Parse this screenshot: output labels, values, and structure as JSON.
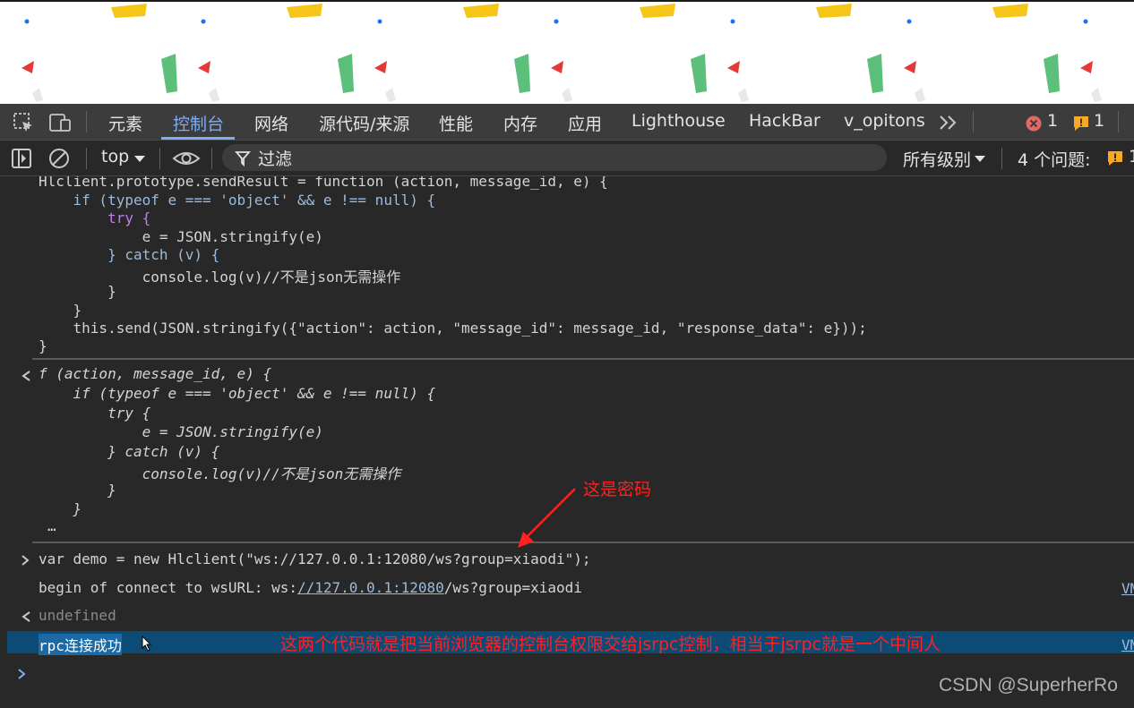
{
  "tabs": {
    "items": [
      "元素",
      "控制台",
      "网络",
      "源代码/来源",
      "性能",
      "内存",
      "应用",
      "Lighthouse",
      "HackBar",
      "v_opitons"
    ],
    "error_count": "1",
    "warning_count": "1"
  },
  "toolbar": {
    "context": "top",
    "filter_placeholder": "过滤",
    "levels": "所有级别",
    "issues": "4 个问题:",
    "issues_count": "1"
  },
  "console": {
    "src_line1": "Hlclient.prototype.sendResult = function (action, message_id, e) {",
    "src_line2": "    if (typeof e === 'object' && e !== null) {",
    "src_line3": "        try {",
    "src_line4": "            e = JSON.stringify(e)",
    "src_line5": "        } catch (v) {",
    "src_line6": "            console.log(v)//不是json无需操作",
    "src_line7": "        }",
    "src_line8": "    }",
    "src_line9": "    this.send(JSON.stringify({\"action\": action, \"message_id\": message_id, \"response_data\": e}));",
    "src_line10": "}",
    "ret_line1": "f (action, message_id, e) {",
    "ret_line2": "    if (typeof e === 'object' && e !== null) {",
    "ret_line3": "        try {",
    "ret_line4": "            e = JSON.stringify(e)",
    "ret_line5": "        } catch (v) {",
    "ret_line6": "            console.log(v)//不是json无需操作",
    "ret_line7": "        }",
    "ret_line8": "    }",
    "ret_line9": "…",
    "input_code": "var demo = new Hlclient(\"ws://127.0.0.1:12080/ws?group=xiaodi\");",
    "log_prefix": "begin of connect to wsURL: ws:",
    "log_url": "//127.0.0.1:12080",
    "log_suffix": "/ws?group=xiaodi",
    "log_source": "VM",
    "undefined_text": "undefined",
    "success_text": "rpc连接成功",
    "success_source": "VM"
  },
  "annotations": {
    "password": "这是密码",
    "explain": "这两个代码就是把当前浏览器的控制台权限交给jsrpc控制，相当于jsrpc就是一个中间人"
  },
  "watermark": "CSDN @SuperherRo",
  "colors": {
    "accent": "#7cacf8",
    "annotation_red": "#ff2020",
    "selection": "#0d4b77"
  }
}
